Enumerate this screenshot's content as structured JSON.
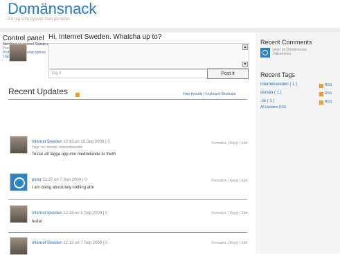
{
  "site": {
    "title": "Domänsnack",
    "tagline": "Ett lag som pysslar med domäner"
  },
  "control_panel": {
    "title": "Control panel",
    "identified": "Identified as Internet Sweden",
    "account": "Your account",
    "profile": "Profile and personal options",
    "logout": "Logout"
  },
  "status_box": {
    "prompt": "Hi, Internet Sweden. Whatcha up to?",
    "tag_placeholder": "Tag it",
    "post_label": "Post it"
  },
  "updates": {
    "title": "Recent Updates",
    "links": "Hide threads | Keyboard Shortcuts",
    "items": [
      {
        "author": "Internet Sweden",
        "meta": "12:43 on 10 Sep 2009 | 0",
        "actions": "Permalink | Reply | Edit",
        "tags": "Tags: se, domän, internetsweden",
        "text": "Testar att lägga upp min meddelande är fredh"
      },
      {
        "author": "peter",
        "meta": "12:37 on 7 Sep 2009 | 0",
        "actions": "Permalink | Reply | Edit",
        "tags": "",
        "text": "I am doing absolutely nothing atm"
      },
      {
        "author": "Internet Sweden",
        "meta": "12:33 on 8 Sep 2009 | 0",
        "actions": "Permalink | Reply | Edit",
        "tags": "",
        "text": "testar"
      },
      {
        "author": "Internet Sweden",
        "meta": "12:13 on 7 Sep 2009 | 0",
        "actions": "Permalink | Reply | Edit",
        "tags": "",
        "text": ""
      }
    ]
  },
  "sidebar": {
    "recent_comments_title": "Recent Comments",
    "comment_line1": "peter on Domänsnack",
    "comment_line2": "Välkommen",
    "recent_tags_title": "Recent Tags",
    "tags": [
      {
        "label": "internetsweden ( 1 )",
        "rss": "RSS"
      },
      {
        "label": "domän ( 1 )",
        "rss": "RSS"
      },
      {
        "label": ".se ( 1 )",
        "rss": "RSS"
      }
    ],
    "all_tags": "All Updates RSS"
  },
  "colors": {
    "accent": "#2477c9",
    "rss": "#f29a36"
  }
}
